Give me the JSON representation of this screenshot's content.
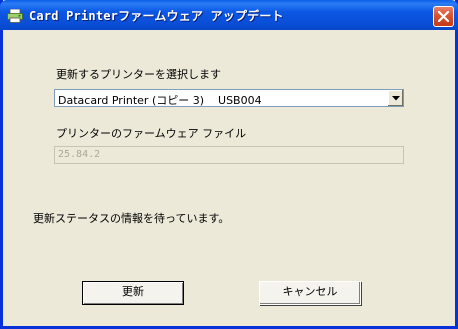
{
  "window": {
    "title": "Card Printerファームウェア アップデート"
  },
  "printer_select": {
    "label": "更新するプリンターを選択します",
    "value": "Datacard Printer (コピー 3)    USB004"
  },
  "firmware": {
    "label": "プリンターのファームウェア ファイル",
    "value": "25.84.2"
  },
  "status": {
    "text": "更新ステータスの情報を待っています。"
  },
  "buttons": {
    "update": "更新",
    "cancel": "キャンセル"
  },
  "icons": {
    "app": "printer-icon",
    "close": "close-icon",
    "dropdown": "chevron-down-icon"
  },
  "colors": {
    "titlebar": "#0A4FD8",
    "close": "#D9532E",
    "window_bg": "#ECE9D8"
  }
}
